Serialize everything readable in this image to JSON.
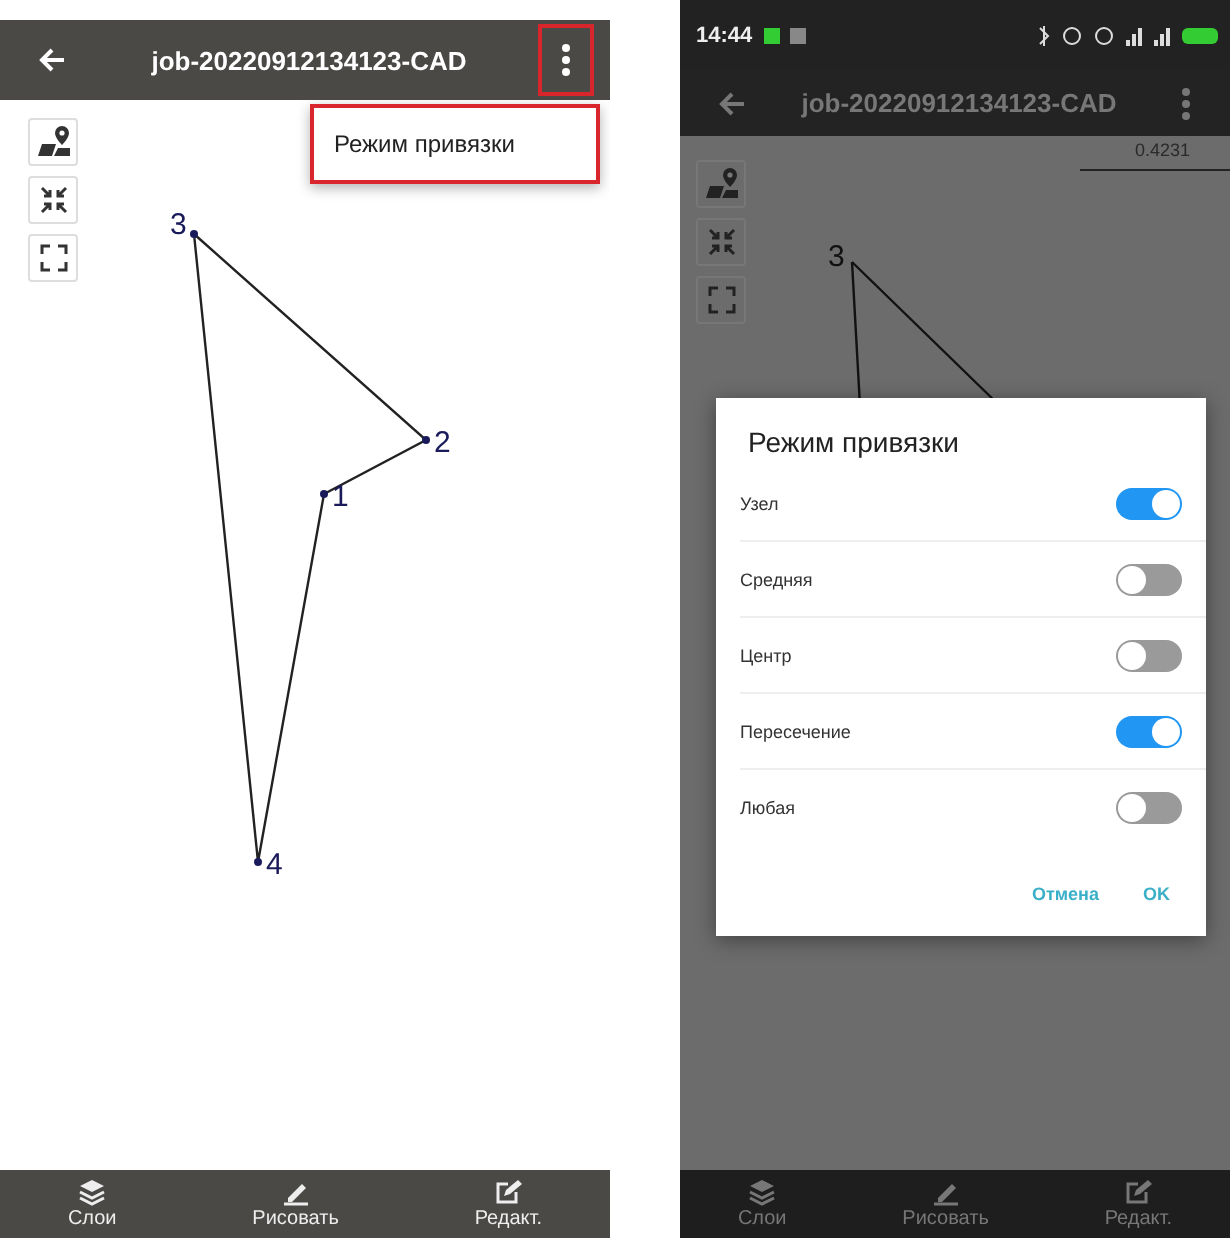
{
  "left_screen": {
    "app_bar": {
      "title": "job-20220912134123-CAD"
    },
    "overflow_menu": {
      "items": [
        "Режим привязки"
      ]
    },
    "canvas": {
      "nodes": [
        "3",
        "2",
        "1",
        "4"
      ]
    },
    "bottom_nav": [
      {
        "label": "Слои"
      },
      {
        "label": "Рисовать"
      },
      {
        "label": "Редакт."
      }
    ]
  },
  "right_screen": {
    "status_bar": {
      "time": "14:44"
    },
    "app_bar": {
      "title": "job-20220912134123-CAD"
    },
    "canvas": {
      "scale": "0.4231",
      "nodes": [
        "3"
      ]
    },
    "dialog": {
      "title": "Режим привязки",
      "options": [
        {
          "label": "Узел",
          "on": true
        },
        {
          "label": "Средняя",
          "on": false
        },
        {
          "label": "Центр",
          "on": false
        },
        {
          "label": "Пересечение",
          "on": true
        },
        {
          "label": "Любая",
          "on": false
        }
      ],
      "buttons": [
        "Отмена",
        "OK"
      ]
    },
    "bottom_nav": [
      {
        "label": "Слои"
      },
      {
        "label": "Рисовать"
      },
      {
        "label": "Редакт."
      }
    ]
  }
}
